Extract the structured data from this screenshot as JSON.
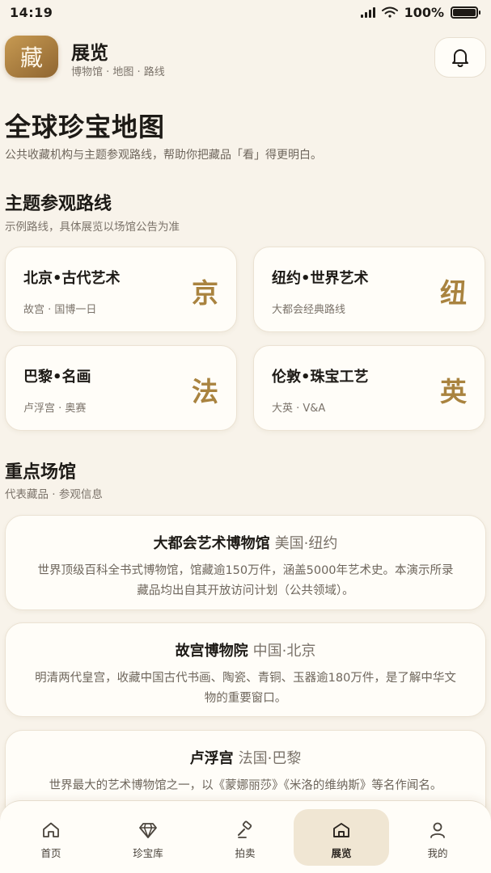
{
  "status": {
    "time": "14:19",
    "battery": "100%"
  },
  "header": {
    "logo_char": "藏",
    "title": "展览",
    "subtitle": "博物馆 · 地图 · 路线"
  },
  "hero": {
    "title": "全球珍宝地图",
    "desc": "公共收藏机构与主题参观路线，帮助你把藏品「看」得更明白。"
  },
  "routes_section": {
    "title": "主题参观路线",
    "sub": "示例路线，具体展览以场馆公告为准",
    "items": [
      {
        "name": "北京•古代艺术",
        "desc": "故宫 · 国博一日",
        "char": "京"
      },
      {
        "name": "纽约•世界艺术",
        "desc": "大都会经典路线",
        "char": "纽"
      },
      {
        "name": "巴黎•名画",
        "desc": "卢浮宫 · 奥赛",
        "char": "法"
      },
      {
        "name": "伦敦•珠宝工艺",
        "desc": "大英 · V&A",
        "char": "英"
      }
    ]
  },
  "venues_section": {
    "title": "重点场馆",
    "sub": "代表藏品 · 参观信息",
    "items": [
      {
        "name": "大都会艺术博物馆",
        "loc": "美国·纽约",
        "desc": "世界顶级百科全书式博物馆，馆藏逾150万件，涵盖5000年艺术史。本演示所录藏品均出自其开放访问计划（公共领域）。"
      },
      {
        "name": "故宫博物院",
        "loc": "中国·北京",
        "desc": "明清两代皇宫，收藏中国古代书画、陶瓷、青铜、玉器逾180万件，是了解中华文物的重要窗口。"
      },
      {
        "name": "卢浮宫",
        "loc": "法国·巴黎",
        "desc": "世界最大的艺术博物馆之一，以《蒙娜丽莎》《米洛的维纳斯》等名作闻名。"
      }
    ]
  },
  "tabs": [
    {
      "label": "首页",
      "icon": "home-icon"
    },
    {
      "label": "珍宝库",
      "icon": "diamond-icon"
    },
    {
      "label": "拍卖",
      "icon": "gavel-icon"
    },
    {
      "label": "展览",
      "icon": "museum-icon",
      "active": true
    },
    {
      "label": "我的",
      "icon": "user-icon"
    }
  ],
  "colors": {
    "accent": "#a9833f",
    "background": "#f8f3ea",
    "card": "#fffdf8"
  }
}
